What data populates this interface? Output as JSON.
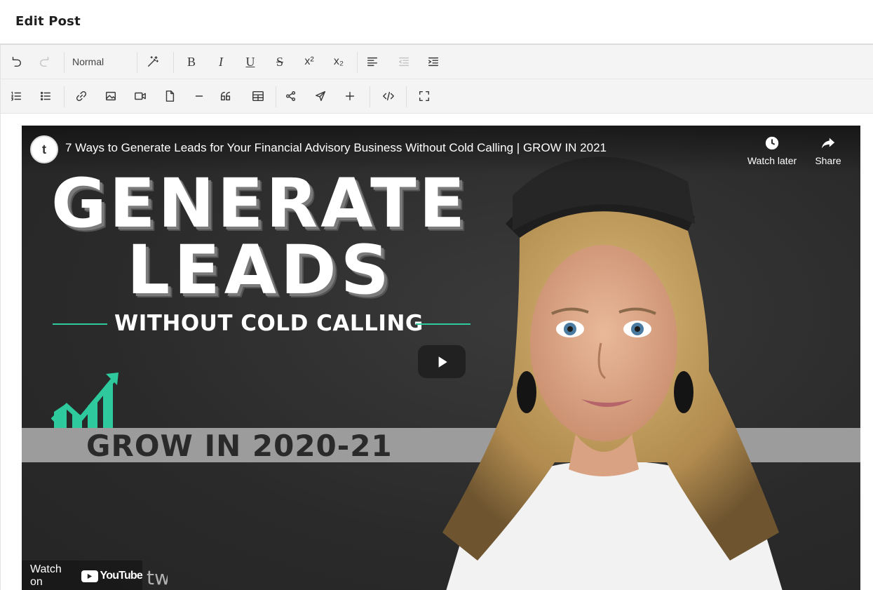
{
  "page": {
    "title": "Edit Post"
  },
  "toolbar": {
    "format_value": "Normal",
    "row1": [
      {
        "name": "undo-icon"
      },
      {
        "name": "redo-icon",
        "disabled": true
      },
      {
        "name": "magic-wand-icon"
      },
      {
        "name": "bold-button",
        "glyph": "B"
      },
      {
        "name": "italic-button",
        "glyph": "I"
      },
      {
        "name": "underline-button",
        "glyph": "U"
      },
      {
        "name": "strikethrough-button",
        "glyph": "S"
      },
      {
        "name": "superscript-button",
        "glyph": "x²"
      },
      {
        "name": "subscript-button",
        "glyph": "x₂"
      },
      {
        "name": "align-left-icon"
      },
      {
        "name": "outdent-icon",
        "disabled": true
      },
      {
        "name": "indent-icon"
      }
    ],
    "row2": [
      "ordered-list-icon",
      "bullet-list-icon",
      "link-icon",
      "image-icon",
      "video-icon",
      "file-icon",
      "horizontal-rule-icon",
      "blockquote-icon",
      "table-icon",
      "share-icon",
      "send-icon",
      "plus-icon",
      "code-icon",
      "fullscreen-icon"
    ]
  },
  "video": {
    "title": "7 Ways to Generate Leads for Your Financial Advisory Business Without Cold Calling | GROW IN 2021",
    "channel_initial": "t",
    "watch_later_label": "Watch later",
    "share_label": "Share",
    "watch_on_label": "Watch on",
    "youtube_label": "YouTube",
    "watermark_text": "twenty over ten",
    "thumbnail": {
      "headline_1": "GENERATE",
      "headline_2": "LEADS",
      "subline": "WITHOUT COLD CALLING",
      "grow_text": "GROW IN 2020-21"
    },
    "colors": {
      "accent": "#2fc99e",
      "band": "#9c9c9c"
    }
  }
}
